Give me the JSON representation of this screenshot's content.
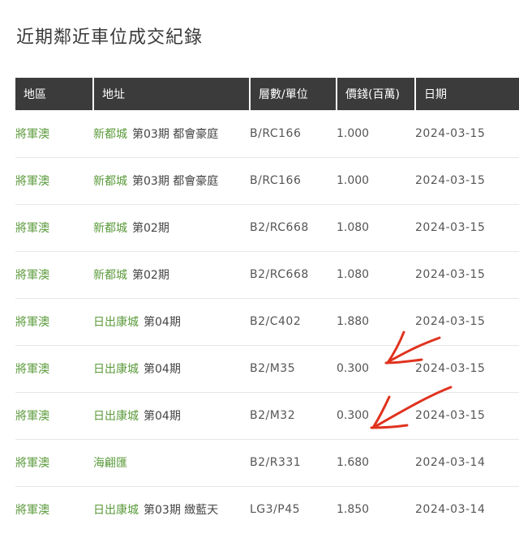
{
  "page": {
    "title": "近期鄰近車位成交紀錄"
  },
  "table": {
    "headers": [
      "地區",
      "地址",
      "層數/單位",
      "價錢(百萬)",
      "日期"
    ],
    "rows": [
      {
        "district": "將軍澳",
        "estate": "新都城",
        "detail": "第03期 都會豪庭",
        "floor": "B/RC166",
        "price": "1.000",
        "date": "2024-03-15"
      },
      {
        "district": "將軍澳",
        "estate": "新都城",
        "detail": "第03期 都會豪庭",
        "floor": "B/RC166",
        "price": "1.000",
        "date": "2024-03-15"
      },
      {
        "district": "將軍澳",
        "estate": "新都城",
        "detail": "第02期",
        "floor": "B2/RC668",
        "price": "1.080",
        "date": "2024-03-15"
      },
      {
        "district": "將軍澳",
        "estate": "新都城",
        "detail": "第02期",
        "floor": "B2/RC668",
        "price": "1.080",
        "date": "2024-03-15"
      },
      {
        "district": "將軍澳",
        "estate": "日出康城",
        "detail": "第04期",
        "floor": "B2/C402",
        "price": "1.880",
        "date": "2024-03-15"
      },
      {
        "district": "將軍澳",
        "estate": "日出康城",
        "detail": "第04期",
        "floor": "B2/M35",
        "price": "0.300",
        "date": "2024-03-15"
      },
      {
        "district": "將軍澳",
        "estate": "日出康城",
        "detail": "第04期",
        "floor": "B2/M32",
        "price": "0.300",
        "date": "2024-03-15"
      },
      {
        "district": "將軍澳",
        "estate": "海翩匯",
        "detail": "",
        "floor": "B2/R331",
        "price": "1.680",
        "date": "2024-03-14"
      },
      {
        "district": "將軍澳",
        "estate": "日出康城",
        "detail": "第03期 緻藍天",
        "floor": "LG3/P45",
        "price": "1.850",
        "date": "2024-03-14"
      }
    ]
  },
  "colors": {
    "header_bg": "#3b3b3b",
    "link_green": "#5a9a3a",
    "annotation_red": "#e0321e"
  },
  "annotations": [
    "red-arrow-icon",
    "red-arrow-icon"
  ]
}
